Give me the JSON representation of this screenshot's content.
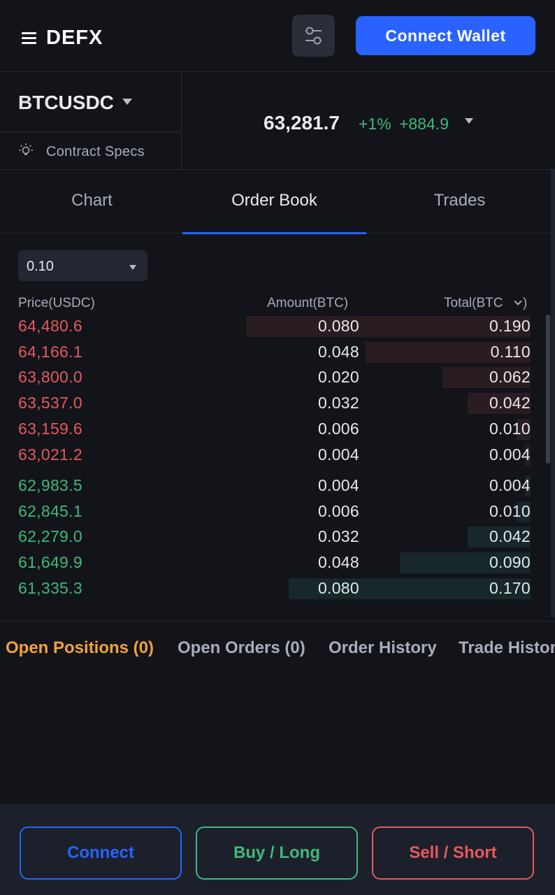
{
  "header": {
    "logo_text": "DEFX",
    "connect_wallet_label": "Connect Wallet"
  },
  "market": {
    "pair": "BTCUSDC",
    "contract_specs_label": "Contract Specs",
    "last_price": "63,281.7",
    "change_pct": "+1%",
    "change_abs": "+884.9"
  },
  "tabs": [
    {
      "label": "Chart",
      "active": false
    },
    {
      "label": "Order Book",
      "active": true
    },
    {
      "label": "Trades",
      "active": false
    }
  ],
  "order_book": {
    "precision": "0.10",
    "headers": {
      "price": "Price(USDC)",
      "amount": "Amount(BTC)",
      "total": "Total(BTC",
      "total_close": ")"
    },
    "asks": [
      {
        "price": "64,480.6",
        "amount": "0.080",
        "total": "0.190",
        "depth": 1.0
      },
      {
        "price": "64,166.1",
        "amount": "0.048",
        "total": "0.110",
        "depth": 0.58
      },
      {
        "price": "63,800.0",
        "amount": "0.020",
        "total": "0.062",
        "depth": 0.31
      },
      {
        "price": "63,537.0",
        "amount": "0.032",
        "total": "0.042",
        "depth": 0.22
      },
      {
        "price": "63,159.6",
        "amount": "0.006",
        "total": "0.010",
        "depth": 0.05
      },
      {
        "price": "63,021.2",
        "amount": "0.004",
        "total": "0.004",
        "depth": 0.02
      }
    ],
    "bids": [
      {
        "price": "62,983.5",
        "amount": "0.004",
        "total": "0.004",
        "depth": 0.02
      },
      {
        "price": "62,845.1",
        "amount": "0.006",
        "total": "0.010",
        "depth": 0.05
      },
      {
        "price": "62,279.0",
        "amount": "0.032",
        "total": "0.042",
        "depth": 0.22
      },
      {
        "price": "61,649.9",
        "amount": "0.048",
        "total": "0.090",
        "depth": 0.46
      },
      {
        "price": "61,335.3",
        "amount": "0.080",
        "total": "0.170",
        "depth": 0.85
      }
    ]
  },
  "position_tabs": [
    {
      "label": "Open Positions (0)",
      "active": true
    },
    {
      "label": "Open Orders (0)",
      "active": false
    },
    {
      "label": "Order History",
      "active": false
    },
    {
      "label": "Trade History",
      "active": false
    }
  ],
  "bottom_bar": {
    "connect_label": "Connect",
    "buy_label": "Buy / Long",
    "sell_label": "Sell / Short"
  },
  "colors": {
    "accent": "#2962ff",
    "ask": "#e5595c",
    "bid": "#3fb87a",
    "active_tab": "#f0a338"
  }
}
